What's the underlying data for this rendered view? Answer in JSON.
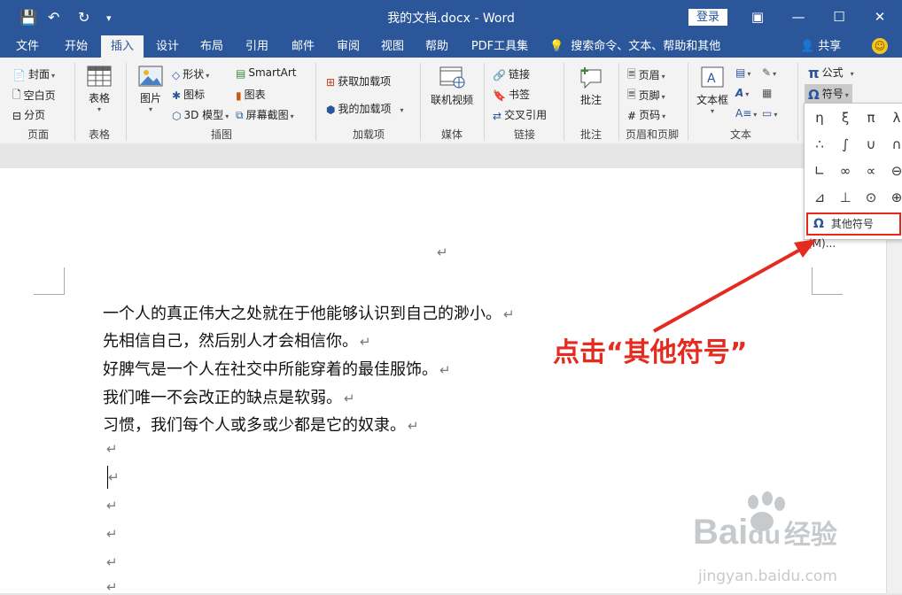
{
  "titlebar": {
    "doc_title": "我的文档.docx - Word",
    "login": "登录",
    "qa_save": "💾",
    "qa_undo": "↶",
    "qa_redo": "↻",
    "qa_customize": "▾",
    "win_ribbon_opts": "▣",
    "win_min": "—",
    "win_max": "☐",
    "win_close": "✕"
  },
  "tabs": [
    "文件",
    "开始",
    "插入",
    "设计",
    "布局",
    "引用",
    "邮件",
    "审阅",
    "视图",
    "帮助",
    "PDF工具集"
  ],
  "active_tab": "插入",
  "tellme": "搜索命令、文本、帮助和其他",
  "share": "共享",
  "ribbon": {
    "pages": {
      "cover": "封面",
      "blank": "空白页",
      "break": "分页",
      "label": "页面"
    },
    "tables": {
      "table": "表格",
      "label": "表格"
    },
    "illustrations": {
      "picture": "图片",
      "shapes": "形状",
      "icons": "图标",
      "model3d": "3D 模型",
      "smartart": "SmartArt",
      "chart": "图表",
      "screenshot": "屏幕截图",
      "label": "插图"
    },
    "addins": {
      "get": "获取加载项",
      "mine": "我的加载项",
      "label": "加载项"
    },
    "media": {
      "video": "联机视频",
      "label": "媒体"
    },
    "links": {
      "link": "链接",
      "bookmark": "书签",
      "xref": "交叉引用",
      "label": "链接"
    },
    "comments": {
      "comment": "批注",
      "label": "批注"
    },
    "headerfooter": {
      "header": "页眉",
      "footer": "页脚",
      "pagenum": "页码",
      "label": "页眉和页脚"
    },
    "text": {
      "textbox": "文本框",
      "label": "文本"
    },
    "symbols": {
      "equation": "公式",
      "symbol": "符号"
    }
  },
  "symbols_grid": [
    [
      "η",
      "ξ",
      "π",
      "λ"
    ],
    [
      "∴",
      "∫",
      "∪",
      "∩"
    ],
    [
      "∟",
      "∞",
      "∝",
      "⊖"
    ],
    [
      "⊿",
      "⊥",
      "⊙",
      "⊕"
    ]
  ],
  "more_symbols": "其他符号(M)...",
  "document": {
    "top_mark": "↵",
    "lines": [
      "一个人的真正伟大之处就在于他能够认识到自己的渺小。",
      "先相信自己，然后别人才会相信你。",
      "好脾气是一个人在社交中所能穿着的最佳服饰。",
      "我们唯一不会改正的缺点是软弱。",
      "习惯，我们每个人或多或少都是它的奴隶。"
    ],
    "paragraph_mark": "↵"
  },
  "annotation": "点击“其他符号”",
  "watermark": {
    "logo_text": "Bai",
    "logo_text2": "du",
    "brand": "经验",
    "url": "jingyan.baidu.com"
  },
  "colors": {
    "word_blue": "#2b579a",
    "ribbon_bg": "#f3f3f3",
    "annotation_red": "#e52a1f"
  }
}
